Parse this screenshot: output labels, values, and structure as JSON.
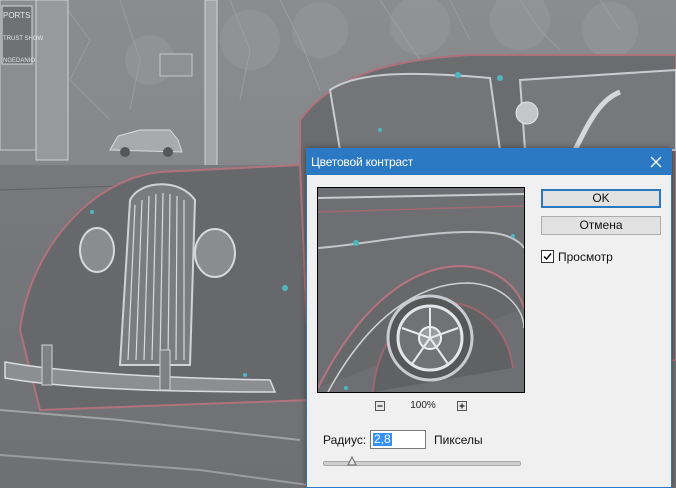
{
  "background": {
    "signs": [
      "PORTS",
      "TRUST SHOW",
      "NGEDANIO"
    ]
  },
  "dialog": {
    "title": "Цветовой контраст",
    "close_icon": "close-icon",
    "zoom": {
      "minus_icon": "zoom-out-icon",
      "plus_icon": "zoom-in-icon",
      "value": "100%"
    },
    "buttons": {
      "ok": "OK",
      "cancel": "Отмена"
    },
    "preview_checkbox": {
      "label": "Просмотр",
      "checked": true
    },
    "radius": {
      "label": "Радиус:",
      "value": "2,8",
      "unit": "Пикселы"
    },
    "accent_color": "#2b79c2"
  }
}
